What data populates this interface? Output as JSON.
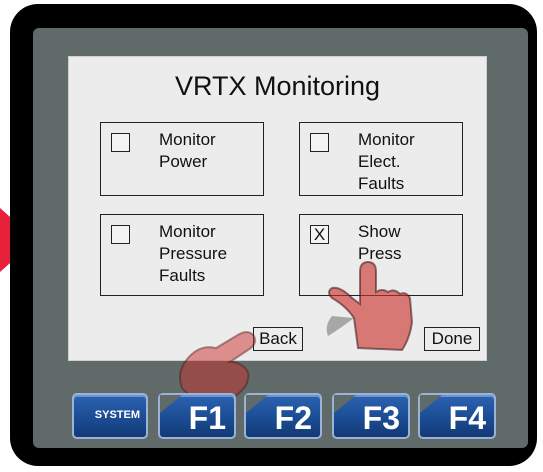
{
  "screen": {
    "title": "VRTX Monitoring",
    "options": [
      {
        "lines": [
          "Monitor",
          "Power"
        ],
        "checked": false,
        "mark": ""
      },
      {
        "lines": [
          "Monitor",
          "Elect.",
          "Faults"
        ],
        "checked": false,
        "mark": ""
      },
      {
        "lines": [
          "Monitor",
          "Pressure",
          "Faults"
        ],
        "checked": false,
        "mark": ""
      },
      {
        "lines": [
          "Show",
          "Press"
        ],
        "checked": true,
        "mark": "X"
      }
    ],
    "back_label": "Back",
    "done_label": "Done"
  },
  "function_keys": [
    {
      "label": "SYSTEM"
    },
    {
      "label": "F1"
    },
    {
      "label": "F2"
    },
    {
      "label": "F3"
    },
    {
      "label": "F4"
    }
  ],
  "colors": {
    "arrow": "#e8203a",
    "bezel": "#000000",
    "faceplate": "#5f6a69",
    "screen": "#ececec",
    "key": "#1f4f97",
    "hand": "#c9302c"
  },
  "icons": {
    "indicator": "red-arrow-icon",
    "touch_primary": "pointing-hand-icon",
    "touch_secondary": "pointing-hand-icon"
  }
}
